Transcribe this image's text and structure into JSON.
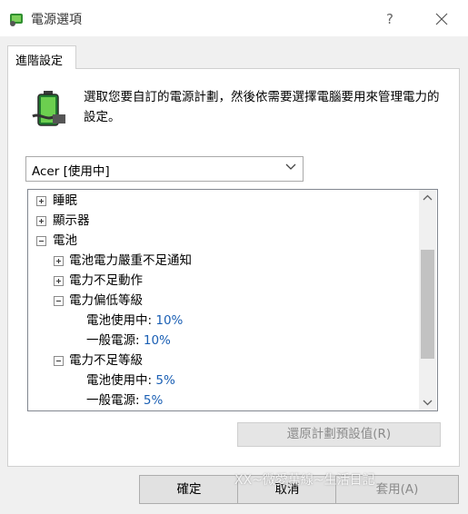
{
  "window": {
    "title": "電源選項",
    "help_label": "?",
    "close_icon": "close-icon"
  },
  "tab": {
    "label": "進階設定"
  },
  "description": "選取您要自訂的電源計劃，然後依需要選擇電腦要用來管理電力的設定。",
  "plan_select": {
    "value": "Acer [使用中]"
  },
  "tree": {
    "sleep": "睡眠",
    "display": "顯示器",
    "battery": "電池",
    "critical_notify": "電池電力嚴重不足通知",
    "low_action": "電力不足動作",
    "low_level": "電力偏低等級",
    "low_level_on_battery_label": "電池使用中:",
    "low_level_on_battery_value": "10%",
    "low_level_plugged_label": "一般電源:",
    "low_level_plugged_value": "10%",
    "reserve_level": "電力不足等級",
    "reserve_on_battery_label": "電池使用中:",
    "reserve_on_battery_value": "5%",
    "reserve_plugged_label": "一般電源:",
    "reserve_plugged_value": "5%"
  },
  "buttons": {
    "restore": "還原計劃預設值(R)",
    "ok": "確定",
    "cancel": "取消",
    "apply": "套用(A)"
  },
  "watermark": "XX~微愛萬線~生活日記",
  "colors": {
    "value_blue": "#1a5fb4",
    "disabled_text": "#8a8a8a"
  }
}
